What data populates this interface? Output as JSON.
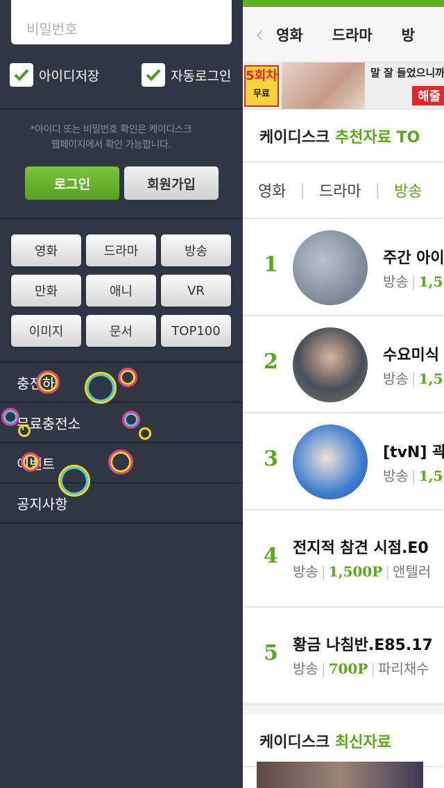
{
  "left_menu": {
    "password_placeholder": "비밀번호",
    "save_id_label": "아이디저장",
    "auto_login_label": "자동로그인",
    "notice_line1": "*아이디 또는 비밀번호 확인은 케이디스크",
    "notice_line2": "웹페이지에서 확인 가능합니다.",
    "login_button": "로그인",
    "join_button": "회원가입",
    "categories": [
      "영화",
      "드라마",
      "방송",
      "만화",
      "애니",
      "VR",
      "이미지",
      "문서",
      "TOP100"
    ],
    "menu_items": [
      "충전하",
      "무료충전소",
      "이벤트",
      "공지사항"
    ]
  },
  "header": {
    "tabs": [
      "영화",
      "드라마",
      "방"
    ]
  },
  "banner": {
    "badge_number": "5회차",
    "badge_sub": "무료",
    "text": "말 잘 들었으니까",
    "button": "해줄"
  },
  "recommended": {
    "title_prefix": "케이디스크 ",
    "title_highlight": "추천자료 TO",
    "filters": [
      "영화",
      "드라마",
      "방송"
    ],
    "items": [
      {
        "rank": "1",
        "title": "주간 아이",
        "category": "방송",
        "points": "1,5",
        "uploader": ""
      },
      {
        "rank": "2",
        "title": "수요미식",
        "category": "방송",
        "points": "1,5",
        "uploader": ""
      },
      {
        "rank": "3",
        "title": "[tvN] 곽",
        "category": "방송",
        "points": "1,5",
        "uploader": ""
      },
      {
        "rank": "4",
        "title": "전지적 참견 시점.E0",
        "category": "방송",
        "points": "1,500P",
        "uploader": "앤텔러"
      },
      {
        "rank": "5",
        "title": "황금 나침반.E85.17",
        "category": "방송",
        "points": "700P",
        "uploader": "파리채수"
      }
    ]
  },
  "latest": {
    "title_prefix": "케이디스크 ",
    "title_highlight": "최신자료"
  },
  "colors": {
    "accent_green": "#5aa91b",
    "left_bg": "#2f3644"
  }
}
